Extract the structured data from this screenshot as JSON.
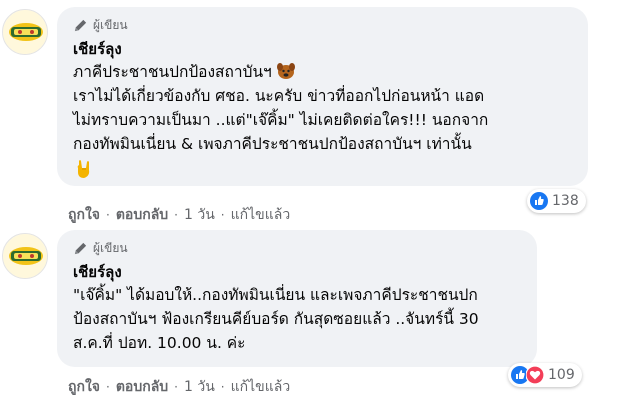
{
  "comments": [
    {
      "badge": "ผู้เขียน",
      "author": "เชียร์ลุง",
      "lines": [
        "ภาคีประชาชนปกป้องสถาบันฯ",
        "เราไม่ได้เกี่ยวข้องกับ ศชอ. นะครับ ข่าวที่ออกไปก่อนหน้า แอด",
        "ไม่ทราบความเป็นมา ..แต่\"เจ๊คิ้ม\" ไม่เคยติดต่อใคร!!! นอกจาก",
        "กองทัพมินเนี่ยน & เพจภาคีประชาชนปกป้องสถาบันฯ เท่านั้น"
      ],
      "reaction_count": "138",
      "actions": {
        "like": "ถูกใจ",
        "reply": "ตอบกลับ",
        "time": "1 วัน",
        "edited": "แก้ไขแล้ว"
      }
    },
    {
      "badge": "ผู้เขียน",
      "author": "เชียร์ลุง",
      "lines": [
        "\"เจ๊คิ้ม\" ได้มอบให้..กองทัพมินเนี่ยน และเพจภาคีประชาชนปก",
        "ป้องสถาบันฯ ฟ้องเกรียนคีย์บอร์ด กันสุดซอยแล้ว ..จันทร์นี้ 30",
        "ส.ค.ที่ ปอท. 10.00 น. ค่ะ"
      ],
      "reaction_count": "109",
      "actions": {
        "like": "ถูกใจ",
        "reply": "ตอบกลับ",
        "time": "1 วัน",
        "edited": "แก้ไขแล้ว"
      }
    }
  ],
  "icons": {
    "pen": "pencil-icon",
    "like": "like-reaction-icon",
    "love": "love-reaction-icon",
    "emoji_1": "dog-face-emoji",
    "emoji_2": "rock-hand-emoji"
  },
  "colors": {
    "bubble": "#f0f2f5",
    "like_blue": "#1877f2",
    "love_red": "#f33e58",
    "meta_gray": "#65676b"
  }
}
